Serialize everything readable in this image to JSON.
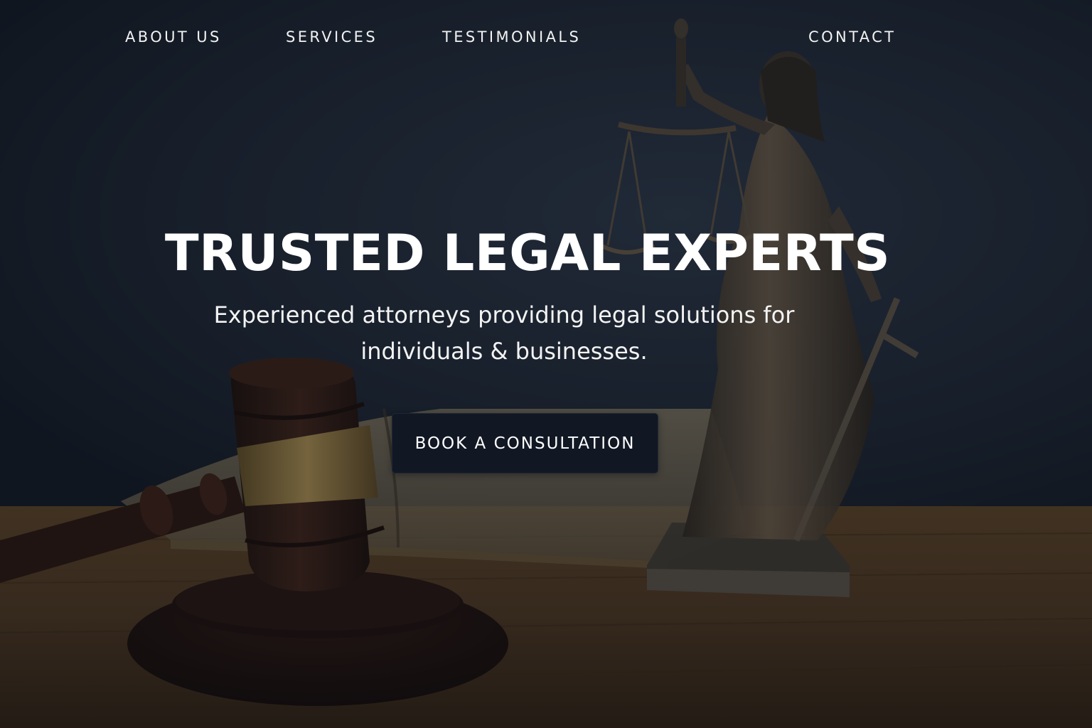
{
  "nav": {
    "items": [
      {
        "label": "ABOUT US"
      },
      {
        "label": "SERVICES"
      },
      {
        "label": "TESTIMONIALS"
      },
      {
        "label": "CONTACT"
      }
    ]
  },
  "hero": {
    "title": "TRUSTED LEGAL EXPERTS",
    "subtitle": "Experienced attorneys providing legal solutions for individuals & businesses.",
    "cta_label": "BOOK A CONSULTATION"
  },
  "background": {
    "depicts": [
      "gavel-icon",
      "lady-justice-statue",
      "open-law-book",
      "wooden-desk"
    ]
  },
  "colors": {
    "backdrop": "#1c2330",
    "desk": "#4a3620",
    "text": "#ffffff",
    "button": "#111824"
  }
}
